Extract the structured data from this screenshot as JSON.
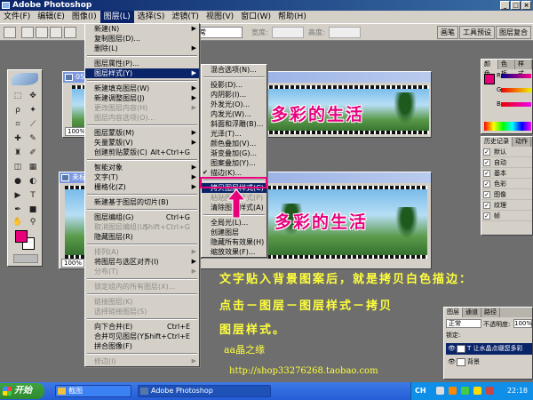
{
  "window": {
    "title": "Adobe Photoshop"
  },
  "menubar": [
    "文件(F)",
    "编辑(E)",
    "图像(I)",
    "图层(L)",
    "选择(S)",
    "滤镜(T)",
    "视图(V)",
    "窗口(W)",
    "帮助(H)"
  ],
  "options": {
    "mode_value": "正常",
    "width_label": "宽度:",
    "height_label": "高度:",
    "dock_tabs": [
      "画笔",
      "工具预设",
      "图层复合"
    ]
  },
  "layer_menu": {
    "groups": [
      [
        {
          "label": "新建(N)",
          "arrow": true
        },
        {
          "label": "复制图层(D)..."
        },
        {
          "label": "删除(L)",
          "arrow": true
        }
      ],
      [
        {
          "label": "图层属性(P)..."
        },
        {
          "label": "图层样式(Y)",
          "arrow": true,
          "selected": true
        }
      ],
      [
        {
          "label": "新建填充图层(W)",
          "arrow": true
        },
        {
          "label": "新建调整图层(J)",
          "arrow": true
        },
        {
          "label": "更改图层内容(H)",
          "arrow": true,
          "disabled": true
        },
        {
          "label": "图层内容选项(O)...",
          "disabled": true
        }
      ],
      [
        {
          "label": "图层蒙版(M)",
          "arrow": true
        },
        {
          "label": "矢量蒙版(V)",
          "arrow": true
        },
        {
          "label": "创建剪贴蒙版(C)",
          "shortcut": "Alt+Ctrl+G"
        }
      ],
      [
        {
          "label": "智能对象",
          "arrow": true
        },
        {
          "label": "文字(T)",
          "arrow": true
        },
        {
          "label": "栅格化(Z)",
          "arrow": true
        }
      ],
      [
        {
          "label": "新建基于图层的切片(B)"
        }
      ],
      [
        {
          "label": "图层编组(G)",
          "shortcut": "Ctrl+G"
        },
        {
          "label": "取消图层编组(U)",
          "shortcut": "Shift+Ctrl+G",
          "disabled": true
        },
        {
          "label": "隐藏图层(R)"
        }
      ],
      [
        {
          "label": "排列(A)",
          "arrow": true,
          "disabled": true
        },
        {
          "label": "将图层与选区对齐(I)",
          "arrow": true
        },
        {
          "label": "分布(T)",
          "arrow": true,
          "disabled": true
        }
      ],
      [
        {
          "label": "锁定组内的所有图层(X)...",
          "disabled": true
        }
      ],
      [
        {
          "label": "链接图层(K)",
          "disabled": true
        },
        {
          "label": "选择链接图层(S)",
          "disabled": true
        }
      ],
      [
        {
          "label": "向下合并(E)",
          "shortcut": "Ctrl+E"
        },
        {
          "label": "合并可见图层(Y)",
          "shortcut": "Shift+Ctrl+E"
        },
        {
          "label": "拼合图像(F)"
        }
      ],
      [
        {
          "label": "修边(I)",
          "arrow": true,
          "disabled": true
        }
      ]
    ]
  },
  "style_submenu": {
    "groups": [
      [
        {
          "label": "混合选项(N)..."
        }
      ],
      [
        {
          "label": "投影(D)..."
        },
        {
          "label": "内阴影(I)..."
        },
        {
          "label": "外发光(O)..."
        },
        {
          "label": "内发光(W)..."
        },
        {
          "label": "斜面和浮雕(B)..."
        },
        {
          "label": "光泽(T)..."
        },
        {
          "label": "颜色叠加(V)..."
        },
        {
          "label": "渐变叠加(G)..."
        },
        {
          "label": "图案叠加(Y)..."
        },
        {
          "label": "描边(K)...",
          "checked": true
        }
      ],
      [
        {
          "label": "拷贝图层样式(C)",
          "selected": true
        },
        {
          "label": "粘贴图层样式(P)",
          "disabled": true
        },
        {
          "label": "清除图层样式(A)"
        }
      ],
      [
        {
          "label": "全局光(L)..."
        },
        {
          "label": "创建图层"
        },
        {
          "label": "隐藏所有效果(H)"
        },
        {
          "label": "缩放效果(F)..."
        }
      ]
    ]
  },
  "doc1": {
    "title": "05",
    "zoom": "100%",
    "text": "多彩的生活"
  },
  "doc2": {
    "title": "未标",
    "zoom": "100%",
    "text": "多彩的生活"
  },
  "color_panel": {
    "tabs": [
      "颜色",
      "色板",
      "样式"
    ],
    "labels": [
      "R",
      "G",
      "B"
    ]
  },
  "history_panel": {
    "tabs": [
      "历史记录",
      "动作"
    ],
    "rows": [
      "默认",
      "自动",
      "基本",
      "色彩",
      "图像",
      "纹理",
      "帧"
    ]
  },
  "layers_panel": {
    "tabs": [
      "图层",
      "通道",
      "路径"
    ],
    "blend": "正常",
    "opacity_label": "不透明度:",
    "opacity": "100%",
    "lock_label": "锁定:",
    "layers": [
      {
        "name": "T 让水晶点缀您多彩",
        "selected": true
      },
      {
        "name": "背景",
        "selected": false
      }
    ]
  },
  "captions": {
    "line1": "文字贴入背景图案后，就是拷贝白色描边：",
    "line2": "点击－图层－图层样式－拷贝",
    "line3": "图层样式。",
    "author": "aa晶之缘",
    "url": "http://shop33276268.taobao.com"
  },
  "taskbar": {
    "start": "开始",
    "tasks": [
      "截图",
      "Adobe Photoshop"
    ],
    "lang": "CH",
    "clock": "22:18"
  }
}
